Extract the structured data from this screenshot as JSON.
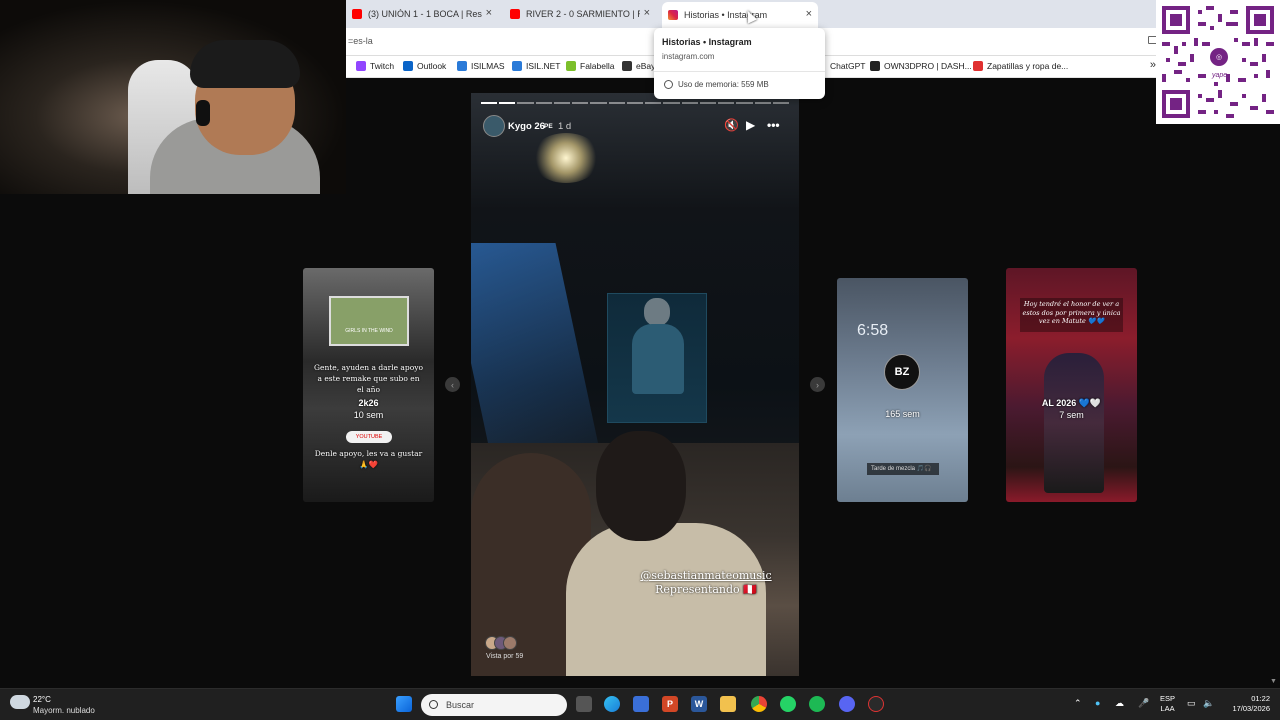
{
  "browser": {
    "tabs": [
      {
        "title": "(3) UNIÓN 1 - 1 BOCA | Resumen",
        "favicon_color": "#ff0000"
      },
      {
        "title": "RIVER 2 - 0 SARMIENTO | Resumen",
        "favicon_color": "#ff0000"
      },
      {
        "title": "Historias • Instagram",
        "favicon_color": "#e1306c",
        "active": true
      }
    ],
    "new_tab": "+",
    "url": "=es-la",
    "bookmarks": [
      {
        "label": "Twitch",
        "icon_color": "#9146ff"
      },
      {
        "label": "Outlook",
        "icon_color": "#0a64c8"
      },
      {
        "label": "ISILMAS",
        "icon_color": "#2a7ad8"
      },
      {
        "label": "ISIL.NET",
        "icon_color": "#2a7ad8"
      },
      {
        "label": "Falabella",
        "icon_color": "#7cbf2a"
      },
      {
        "label": "eBay",
        "icon_color": "#333333"
      },
      {
        "label": "ChatGPT",
        "icon_color": "#ffffff"
      },
      {
        "label": "OWN3DPRO | DASH...",
        "icon_color": "#222222"
      },
      {
        "label": "Zapatillas y ropa de...",
        "icon_color": "#e03030"
      }
    ],
    "bookmarks_more": "»",
    "tooltip": {
      "title": "Historias • Instagram",
      "domain": "instagram.com",
      "memory": "Uso de memoria: 559 MB"
    }
  },
  "qr": {
    "brand": "yape"
  },
  "story": {
    "username": "Kygo 26",
    "badge": "PE",
    "time": "1 d",
    "progress_total": 17,
    "progress_done": 2,
    "mention": "@sebastianmateomusic",
    "caption": "Representando 🇵🇪",
    "views": "Vista por 59"
  },
  "thumbs": {
    "left": {
      "card_text": "GIRLS IN THE WIND",
      "text": "Gente, ayuden a darle apoyo a este remake que subo en el año",
      "label": "2k26",
      "sub": "10 sem",
      "yt": "YOUTUBE",
      "bottom": "Denle apoyo, les va a gustar 🙏❤️"
    },
    "right1": {
      "time": "6:58",
      "avatar": "BZ",
      "sub": "165 sem",
      "tag": "Tarde de mezcla 🎵🎧"
    },
    "right2": {
      "quote": "Hoy tendré el honor de ver a estos dos por primera y única vez en Matute 💙💙",
      "label": "AL 2026 💙🤍",
      "sub": "7 sem"
    }
  },
  "taskbar": {
    "weather_temp": "22°C",
    "weather_desc": "Mayorm. nublado",
    "search_placeholder": "Buscar",
    "lang_top": "ESP",
    "lang_bottom": "LAA",
    "time": "01:22",
    "date": "17/03/2026"
  }
}
